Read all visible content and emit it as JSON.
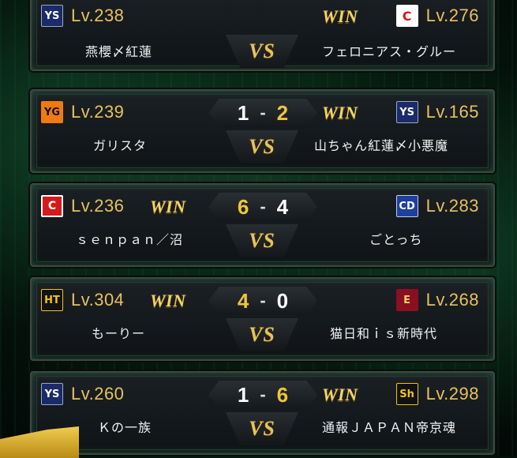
{
  "win_label": "WIN",
  "vs_label": "VS",
  "matches": [
    {
      "left": {
        "team_icon": "swallows-logo",
        "level": "Lv.238",
        "name": "燕櫻〆紅蓮"
      },
      "right": {
        "team_icon": "carp-logo",
        "level": "Lv.276",
        "name": "フェロニアス・グルー"
      },
      "score_left": "",
      "score_right": "",
      "winner": "right"
    },
    {
      "left": {
        "team_icon": "giants-logo",
        "level": "Lv.239",
        "name": "ガリスタ"
      },
      "right": {
        "team_icon": "swallows-logo",
        "level": "Lv.165",
        "name": "山ちゃん紅蓮〆小悪魔"
      },
      "score_left": "1",
      "score_right": "2",
      "winner": "right"
    },
    {
      "left": {
        "team_icon": "carp-logo",
        "level": "Lv.236",
        "name": "ｓｅｎｐａｎ／沼"
      },
      "right": {
        "team_icon": "dragons-logo",
        "level": "Lv.283",
        "name": "ごとっち"
      },
      "score_left": "6",
      "score_right": "4",
      "winner": "left"
    },
    {
      "left": {
        "team_icon": "tigers-logo",
        "level": "Lv.304",
        "name": "もーりー"
      },
      "right": {
        "team_icon": "eagles-logo",
        "level": "Lv.268",
        "name": "猫日和ｉｓ新時代"
      },
      "score_left": "4",
      "score_right": "0",
      "winner": "left"
    },
    {
      "left": {
        "team_icon": "swallows-logo",
        "level": "Lv.260",
        "name": "Ｋの一族"
      },
      "right": {
        "team_icon": "hawks-logo",
        "level": "Lv.298",
        "name": "通報ＪＡＰＡＮ帝京魂"
      },
      "score_left": "1",
      "score_right": "6",
      "winner": "right"
    }
  ],
  "colors": {
    "gold": "#e7c25e",
    "winner_score": "#f0c43c",
    "loser_score": "#ffffff",
    "panel": "#161a1d"
  }
}
